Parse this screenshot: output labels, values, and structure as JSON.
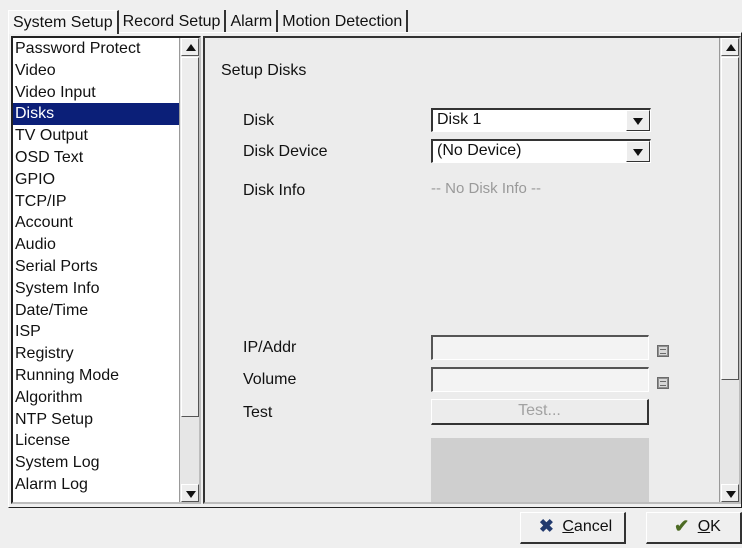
{
  "tabs": [
    "System Setup",
    "Record Setup",
    "Alarm",
    "Motion Detection"
  ],
  "sidebar": {
    "items": [
      "Password Protect",
      "Video",
      "Video Input",
      "Disks",
      "TV Output",
      "OSD Text",
      "GPIO",
      "TCP/IP",
      "Account",
      "Audio",
      "Serial Ports",
      "System Info",
      "Date/Time",
      "ISP",
      "Registry",
      "Running Mode",
      "Algorithm",
      "NTP Setup",
      "License",
      "System Log",
      "Alarm Log"
    ]
  },
  "main": {
    "section_title": "Setup Disks",
    "disk_label": "Disk",
    "disk_value": "Disk 1",
    "disk_device_label": "Disk Device",
    "disk_device_value": "(No Device)",
    "disk_info_label": "Disk Info",
    "disk_info_value": "-- No Disk Info --",
    "ip_label": "IP/Addr",
    "ip_value": "",
    "volume_label": "Volume",
    "volume_value": "",
    "test_label": "Test",
    "test_button_label": "Test..."
  },
  "buttons": {
    "cancel_prefix": "",
    "cancel_underlined": "C",
    "cancel_rest": "ancel",
    "ok_prefix": "",
    "ok_underlined": "O",
    "ok_rest": "K"
  },
  "icons": {
    "cancel": "x-icon",
    "ok": "check-icon",
    "calculator": "calculator-icon"
  },
  "colors": {
    "selected_bg": "#0b1f78",
    "selected_fg": "#ffffff",
    "disabled_text": "#9a9a9a"
  }
}
